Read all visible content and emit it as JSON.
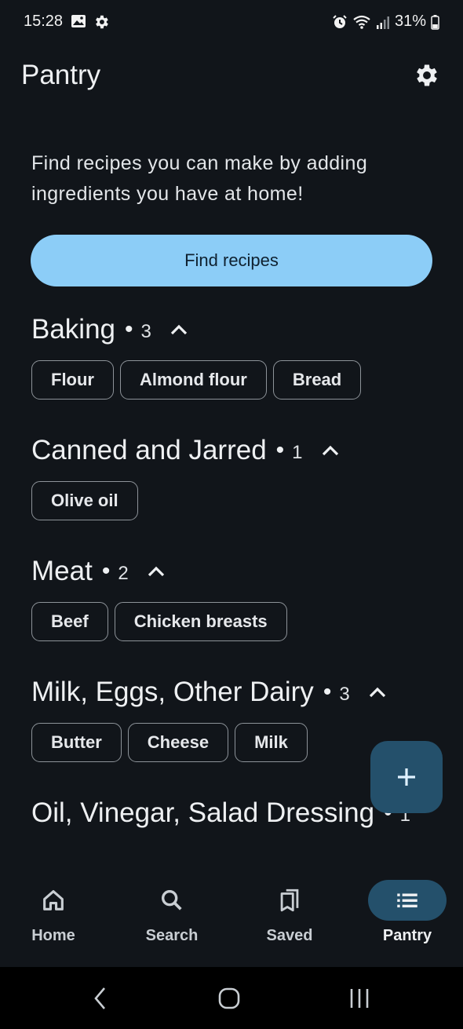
{
  "status_bar": {
    "time": "15:28",
    "battery": "31%",
    "left_icons": [
      "image-icon",
      "gear-status-icon"
    ],
    "right_icons": [
      "alarm-icon",
      "wifi-icon",
      "signal-icon",
      "battery-icon"
    ]
  },
  "header": {
    "title": "Pantry",
    "settings_icon": "gear-icon"
  },
  "intro": {
    "text": "Find recipes you can make by adding ingredients you have at home!"
  },
  "find_button": {
    "label": "Find recipes"
  },
  "categories": [
    {
      "name": "Baking",
      "dot": "•",
      "count": "3",
      "items": [
        "Flour",
        "Almond flour",
        "Bread"
      ]
    },
    {
      "name": "Canned and Jarred",
      "dot": "•",
      "count": "1",
      "items": [
        "Olive oil"
      ]
    },
    {
      "name": "Meat",
      "dot": "•",
      "count": "2",
      "items": [
        "Beef",
        "Chicken breasts"
      ]
    },
    {
      "name": "Milk, Eggs, Other Dairy",
      "dot": "•",
      "count": "3",
      "items": [
        "Butter",
        "Cheese",
        "Milk"
      ]
    },
    {
      "name": "Oil, Vinegar, Salad Dressing",
      "dot": "•",
      "count": "1",
      "items": []
    }
  ],
  "fab": {
    "icon": "plus-icon"
  },
  "bottom_nav": {
    "items": [
      {
        "label": "Home",
        "icon": "home-icon",
        "active": false
      },
      {
        "label": "Search",
        "icon": "search-icon",
        "active": false
      },
      {
        "label": "Saved",
        "icon": "bookmarks-icon",
        "active": false
      },
      {
        "label": "Pantry",
        "icon": "list-icon",
        "active": true
      }
    ]
  },
  "colors": {
    "background": "#11151a",
    "primary_button": "#8ccdf7",
    "accent_container": "#24506b",
    "chip_border": "#8d9399"
  }
}
